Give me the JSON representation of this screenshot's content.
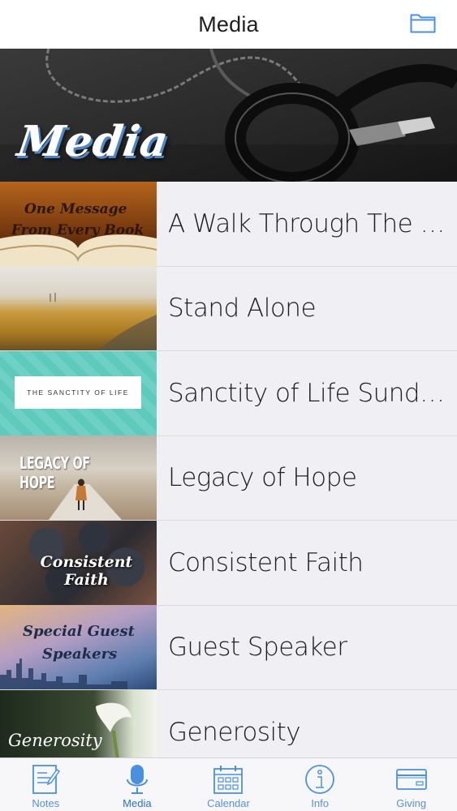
{
  "nav": {
    "title": "Media"
  },
  "hero": {
    "title": "Media"
  },
  "series": [
    {
      "label": "A Walk Through The Bi…",
      "thumb_text": [
        "One Message",
        "From Every Book"
      ]
    },
    {
      "label": "Stand Alone",
      "thumb_text": []
    },
    {
      "label": "Sanctity of Life Sunday",
      "thumb_text": [
        "THE SANCTITY OF LIFE"
      ]
    },
    {
      "label": "Legacy of Hope",
      "thumb_text": [
        "LEGACY OF HOPE"
      ]
    },
    {
      "label": "Consistent Faith",
      "thumb_text": [
        "Consistent Faith"
      ]
    },
    {
      "label": "Guest Speaker",
      "thumb_text": [
        "Special Guest",
        "Speakers"
      ]
    },
    {
      "label": "Generosity",
      "thumb_text": [
        "Generosity"
      ]
    }
  ],
  "tabs": [
    {
      "label": "Notes",
      "icon": "notes-icon"
    },
    {
      "label": "Media",
      "icon": "microphone-icon",
      "active": true
    },
    {
      "label": "Calendar",
      "icon": "calendar-icon"
    },
    {
      "label": "Info",
      "icon": "info-icon"
    },
    {
      "label": "Giving",
      "icon": "credit-card-icon"
    }
  ],
  "colors": {
    "accent": "#4a90e2",
    "tab_label": "#5b8fd6",
    "list_bg": "#efeff4"
  }
}
